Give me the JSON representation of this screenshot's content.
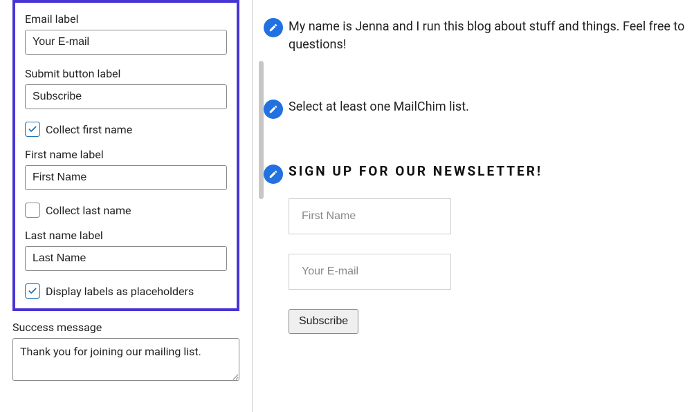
{
  "sidebar": {
    "email_label_caption": "Email label",
    "email_label_value": "Your E-mail",
    "submit_caption": "Submit button label",
    "submit_value": "Subscribe",
    "collect_first_name_label": "Collect first name",
    "collect_first_name_checked": true,
    "first_name_caption": "First name label",
    "first_name_value": "First Name",
    "collect_last_name_label": "Collect last name",
    "collect_last_name_checked": false,
    "last_name_caption": "Last name label",
    "last_name_value": "Last Name",
    "display_placeholders_label": "Display labels as placeholders",
    "display_placeholders_checked": true,
    "success_caption": "Success message",
    "success_value": "Thank you for joining our mailing list."
  },
  "preview": {
    "intro_text": "My name is Jenna and I run this blog about stuff and things. Feel free to questions!",
    "warning_text": "Select at least one MailChim list.",
    "newsletter_heading": "SIGN UP FOR OUR NEWSLETTER!",
    "first_name_placeholder": "First Name",
    "email_placeholder": "Your E-mail",
    "subscribe_label": "Subscribe"
  }
}
